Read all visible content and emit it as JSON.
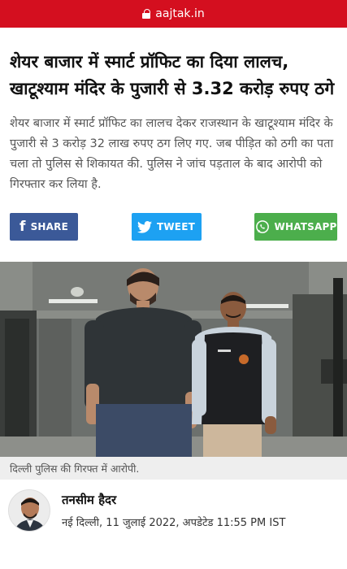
{
  "browser": {
    "url": "aajtak.in"
  },
  "article": {
    "headline": "शेयर बाजार में स्मार्ट प्रॉफिट का दिया लालच, खाटूश्याम मंदिर के पुजारी से 3.32 करोड़ रुपए ठगे",
    "lede": "शेयर बाजार में स्मार्ट प्रॉफिट का लालच देकर राजस्थान के खाटूश्याम मंदिर के पुजारी से 3 करोड़ 32 लाख रुपए ठग लिए गए. जब पीड़ित को ठगी का पता चला तो पुलिस से शिकायत की. पुलिस ने जांच पड़ताल के बाद आरोपी को गिरफ्तार कर लिया है.",
    "image_caption": "दिल्ली पुलिस की गिरफ्त में आरोपी.",
    "author_name": "तनसीम हैदर",
    "dateline": "नई दिल्ली, 11 जुलाई 2022, अपडेटेड 11:55 PM IST"
  },
  "share": {
    "facebook_label": "SHARE",
    "twitter_label": "TWEET",
    "whatsapp_label": "WHATSAPP",
    "facebook_glyph": "f"
  },
  "colors": {
    "url_bar": "#d40f1f",
    "facebook": "#3b5998",
    "twitter": "#1da1f2",
    "whatsapp": "#4cae4c"
  }
}
